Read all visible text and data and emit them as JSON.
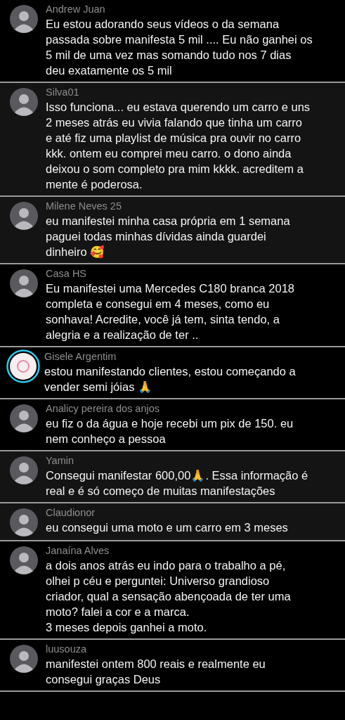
{
  "comments": [
    {
      "author": "Andrew Juan",
      "shaded": false,
      "story_ring": false,
      "text": "Eu estou adorando seus vídeos o da semana\npassada sobre manifesta 5 mil .... Eu não ganhei os\n5 mil de uma vez mas somando tudo nos 7 dias\ndeu exatamente os 5 mil"
    },
    {
      "author": "Silva01",
      "shaded": true,
      "story_ring": false,
      "text": "Isso funciona... eu estava querendo um carro e uns\n2 meses atrás eu vivia falando que tinha um carro\ne até fiz uma playlist de música pra ouvir no carro\nkkk. ontem eu comprei meu carro. o dono ainda\ndeixou o som completo pra mim kkkk. acreditem a\nmente é poderosa."
    },
    {
      "author": "Milene Neves 25",
      "shaded": true,
      "story_ring": false,
      "text": "eu manifestei minha casa própria em 1 semana\npaguei todas minhas dívidas ainda guardei\ndinheiro 🥰"
    },
    {
      "author": "Casa HS",
      "shaded": false,
      "story_ring": false,
      "text": "Eu manifestei uma Mercedes C180 branca 2018\ncompleta e consegui em 4 meses, como eu\nsonhava! Acredite, você já tem, sinta tendo, a\nalegria e a realização de ter .."
    },
    {
      "author": "Gisele Argentim",
      "shaded": false,
      "story_ring": true,
      "text": "estou manifestando clientes, estou começando a\nvender semi jóias 🙏"
    },
    {
      "author": "Analicy pereira dos anjos",
      "shaded": false,
      "story_ring": false,
      "text": "eu fiz o da água e hoje recebi um pix de 150. eu\nnem conheço a pessoa"
    },
    {
      "author": "Yamin",
      "shaded": true,
      "story_ring": false,
      "text": "Consegui manifestar 600,00🙏. Essa informação é\nreal e é só começo de muitas manifestações"
    },
    {
      "author": "Claudionor",
      "shaded": true,
      "story_ring": false,
      "text": "eu consegui uma moto e um carro em 3 meses"
    },
    {
      "author": "Janaína Alves",
      "shaded": false,
      "story_ring": false,
      "text": "a dois anos atrás eu indo para o trabalho a pé,\nolhei p céu e perguntei: Universo grandioso\ncriador, qual a sensação abençoada de ter uma\nmoto? falei a cor e a marca.\n3 meses depois ganhei a moto."
    },
    {
      "author": "luusouza",
      "shaded": false,
      "story_ring": false,
      "text": "manifestei ontem 800 reais e realmente eu\nconsegui graças Deus"
    }
  ]
}
